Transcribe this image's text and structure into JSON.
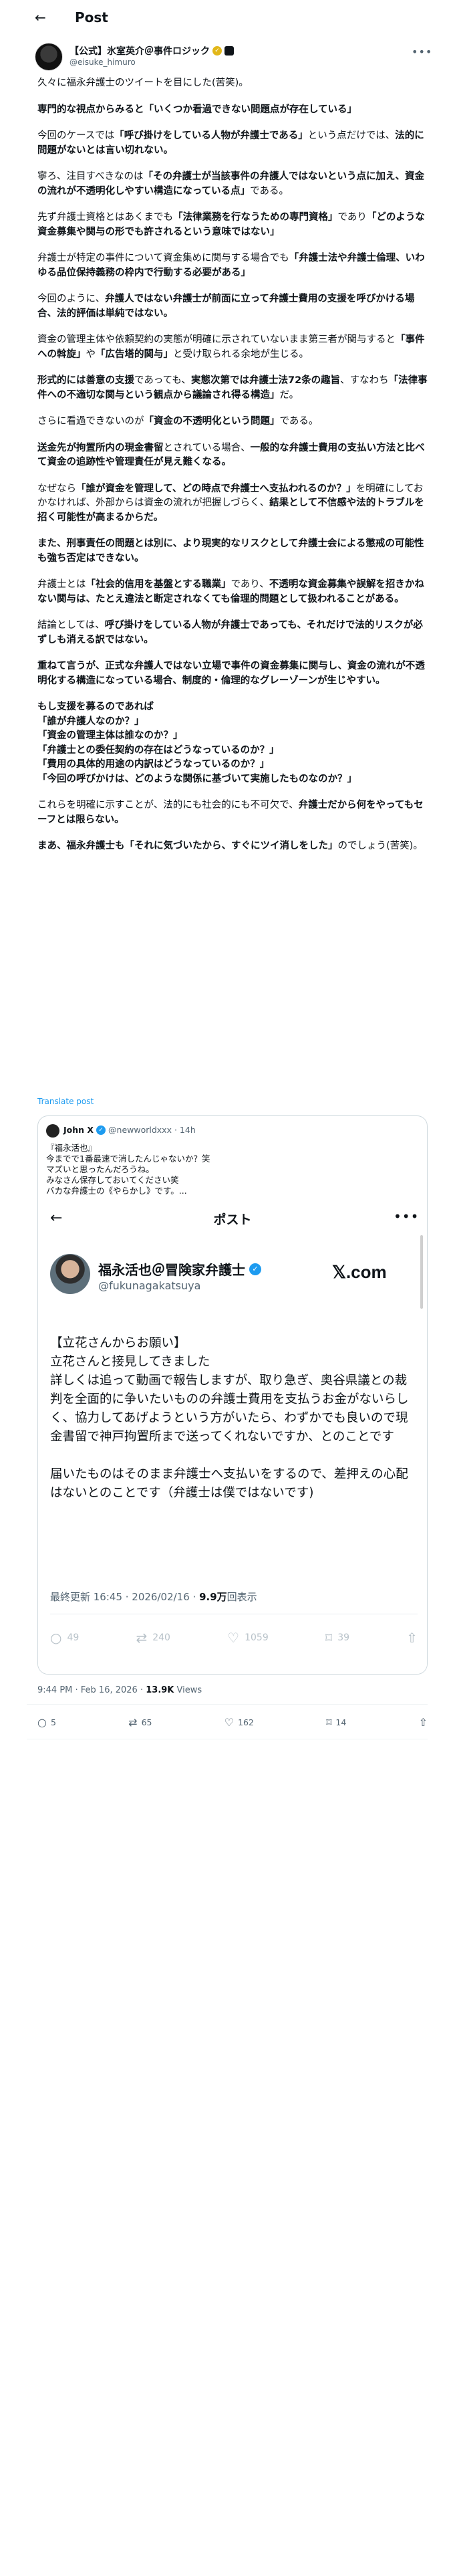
{
  "header": {
    "back_icon": "arrow-left-icon",
    "title": "Post"
  },
  "author": {
    "name": "【公式】氷室英介＠事件ロジック",
    "handle": "@eisuke_himuro"
  },
  "post": {
    "paragraphs": [
      [
        {
          "t": "久々に福永弁護士のツイートを目にした(苦笑)。",
          "b": false
        }
      ],
      [
        {
          "t": "専門的な視点からみると「いくつか看過できない問題点が存在している」",
          "b": true
        }
      ],
      [
        {
          "t": "今回のケースでは",
          "b": false
        },
        {
          "t": "「呼び掛けをしている人物が弁護士である」",
          "b": true
        },
        {
          "t": "という点だけでは、",
          "b": false
        },
        {
          "t": "法的に問題がないとは言い切れない。",
          "b": true
        }
      ],
      [
        {
          "t": "寧ろ、注目すべきなのは",
          "b": false
        },
        {
          "t": "「その弁護士が当該事件の弁護人ではないという点に加え、資金の流れが不透明化しやすい構造になっている点」",
          "b": true
        },
        {
          "t": "である。",
          "b": false
        }
      ],
      [
        {
          "t": "先ず弁護士資格とはあくまでも",
          "b": false
        },
        {
          "t": "「法律業務を行なうための専門資格」",
          "b": true
        },
        {
          "t": "であり",
          "b": false
        },
        {
          "t": "「どのような資金募集や関与の形でも許されるという意味ではない」",
          "b": true
        }
      ],
      [
        {
          "t": "弁護士が特定の事件について資金集めに関与する場合でも",
          "b": false
        },
        {
          "t": "「弁護士法や弁護士倫理、いわゆる品位保持義務の枠内で行動する必要がある」",
          "b": true
        }
      ],
      [
        {
          "t": "今回のように、",
          "b": false
        },
        {
          "t": "弁護人ではない弁護士が前面に立って弁護士費用の支援を呼びかける場合、法的評価は単純ではない。",
          "b": true
        }
      ],
      [
        {
          "t": "資金の管理主体や依頼契約の実態が明確に示されていないまま第三者が関与すると",
          "b": false
        },
        {
          "t": "「事件への斡旋」",
          "b": true
        },
        {
          "t": "や",
          "b": false
        },
        {
          "t": "「広告塔的関与」",
          "b": true
        },
        {
          "t": "と受け取られる余地が生じる。",
          "b": false
        }
      ],
      [
        {
          "t": "形式的には善意の支援",
          "b": true
        },
        {
          "t": "であっても、",
          "b": false
        },
        {
          "t": "実態次第では弁護士法72条の趣旨",
          "b": true
        },
        {
          "t": "、すなわち",
          "b": false
        },
        {
          "t": "「法律事件への不適切な関与という観点から議論され得る構造」",
          "b": true
        },
        {
          "t": "だ。",
          "b": false
        }
      ],
      [
        {
          "t": "さらに看過できないのが",
          "b": false
        },
        {
          "t": "「資金の不透明化という問題」",
          "b": true
        },
        {
          "t": "である。",
          "b": false
        }
      ],
      [
        {
          "t": "送金先が拘置所内の現金書留",
          "b": true
        },
        {
          "t": "とされている場合、",
          "b": false
        },
        {
          "t": "一般的な弁護士費用の支払い方法と比べて資金の追跡性や管理責任が見え難くなる。",
          "b": true
        }
      ],
      [
        {
          "t": "なぜなら",
          "b": false
        },
        {
          "t": "「誰が資金を管理して、どの時点で弁護士へ支払われるのか？」",
          "b": true
        },
        {
          "t": "を明確にしておかなければ、外部からは資金の流れが把握しづらく、",
          "b": false
        },
        {
          "t": "結果として不信感や法的トラブルを招く可能性が高まるからだ。",
          "b": true
        }
      ],
      [
        {
          "t": "また、刑事責任の問題とは別に、より現実的なリスクとして弁護士会による懲戒の可能性も強ち否定はできない。",
          "b": true
        }
      ],
      [
        {
          "t": "弁護士とは",
          "b": false
        },
        {
          "t": "「社会的信用を基盤とする職業」",
          "b": true
        },
        {
          "t": "であり、",
          "b": false
        },
        {
          "t": "不透明な資金募集や誤解を招きかねない関与は、たとえ違法と断定されなくても倫理的問題として扱われることがある。",
          "b": true
        }
      ],
      [
        {
          "t": "結論としては、",
          "b": false
        },
        {
          "t": "呼び掛けをしている人物が弁護士であっても、それだけで法的リスクが必ずしも消える訳ではない。",
          "b": true
        }
      ],
      [
        {
          "t": "重ねて言うが、正式な弁護人ではない立場で事件の資金募集に関与し、資金の流れが不透明化する構造になっている場合、制度的・倫理的なグレーゾーンが生じやすい。",
          "b": true
        }
      ],
      [
        {
          "t": "もし支援を募るのであれば\n「誰が弁護人なのか？」\n「資金の管理主体は誰なのか？」\n「弁護士との委任契約の存在はどうなっているのか？」\n「費用の具体的用途の内訳はどうなっているのか？」\n「今回の呼びかけは、どのような関係に基づいて実施したものなのか？」",
          "b": true
        }
      ],
      [
        {
          "t": "これらを明確に示すことが、法的にも社会的にも不可欠で、",
          "b": false
        },
        {
          "t": "弁護士だから何をやってもセーフとは限らない。",
          "b": true
        }
      ],
      [
        {
          "t": "まあ、福永弁護士も「それに気づいたから、すぐにツイ消しをした」",
          "b": true
        },
        {
          "t": "のでしょう(苦笑)。",
          "b": false
        }
      ]
    ],
    "translate_label": "Translate post",
    "timestamp": "9:44 PM · Feb 16, 2026",
    "views_count": "13.9K",
    "views_label": "Views",
    "actions": [
      {
        "name": "reply",
        "icon": "reply-icon",
        "count": "5"
      },
      {
        "name": "repost",
        "icon": "repost-icon",
        "count": "65"
      },
      {
        "name": "like",
        "icon": "heart-icon",
        "count": "162"
      },
      {
        "name": "bookmark",
        "icon": "bookmark-icon",
        "count": "14"
      },
      {
        "name": "share",
        "icon": "share-icon",
        "count": ""
      }
    ]
  },
  "quote": {
    "name": "John X",
    "handle": "@newworldxxx",
    "time": "· 14h",
    "text": "『福永活也』\n今までで1番最速で消したんじゃないか？笑\nマズいと思ったんだろうね。\nみなさん保存しておいてください笑\nバカな弁護士の《やらかし》です。...",
    "screenshot": {
      "title": "ポスト",
      "name": "福永活也＠冒険家弁護士",
      "handle": "@fukunagakatsuya",
      "brand": "𝕏.com",
      "paragraphs": [
        "【立花さんからお願い】\n立花さんと接見してきました\n詳しくは追って動画で報告しますが、取り急ぎ、奥谷県議との裁判を全面的に争いたいものの弁護士費用を支払うお金がないらしく、協力してあげようという方がいたら、わずかでも良いので現金書留で神戸拘置所まで送ってくれないですか、とのことです",
        "届いたものはそのまま弁護士へ支払いをするので、差押えの心配はないとのことです（弁護士は僕ではないです)"
      ],
      "footer_time": "最終更新 16:45 · 2026/02/16 · ",
      "footer_views": "9.9万",
      "footer_views_label": "回表示",
      "actions": [
        {
          "icon": "reply-icon",
          "count": "49"
        },
        {
          "icon": "repost-icon",
          "count": "240"
        },
        {
          "icon": "heart-icon",
          "count": "1059"
        },
        {
          "icon": "bookmark-icon",
          "count": "39"
        },
        {
          "icon": "share-icon",
          "count": ""
        }
      ]
    }
  }
}
